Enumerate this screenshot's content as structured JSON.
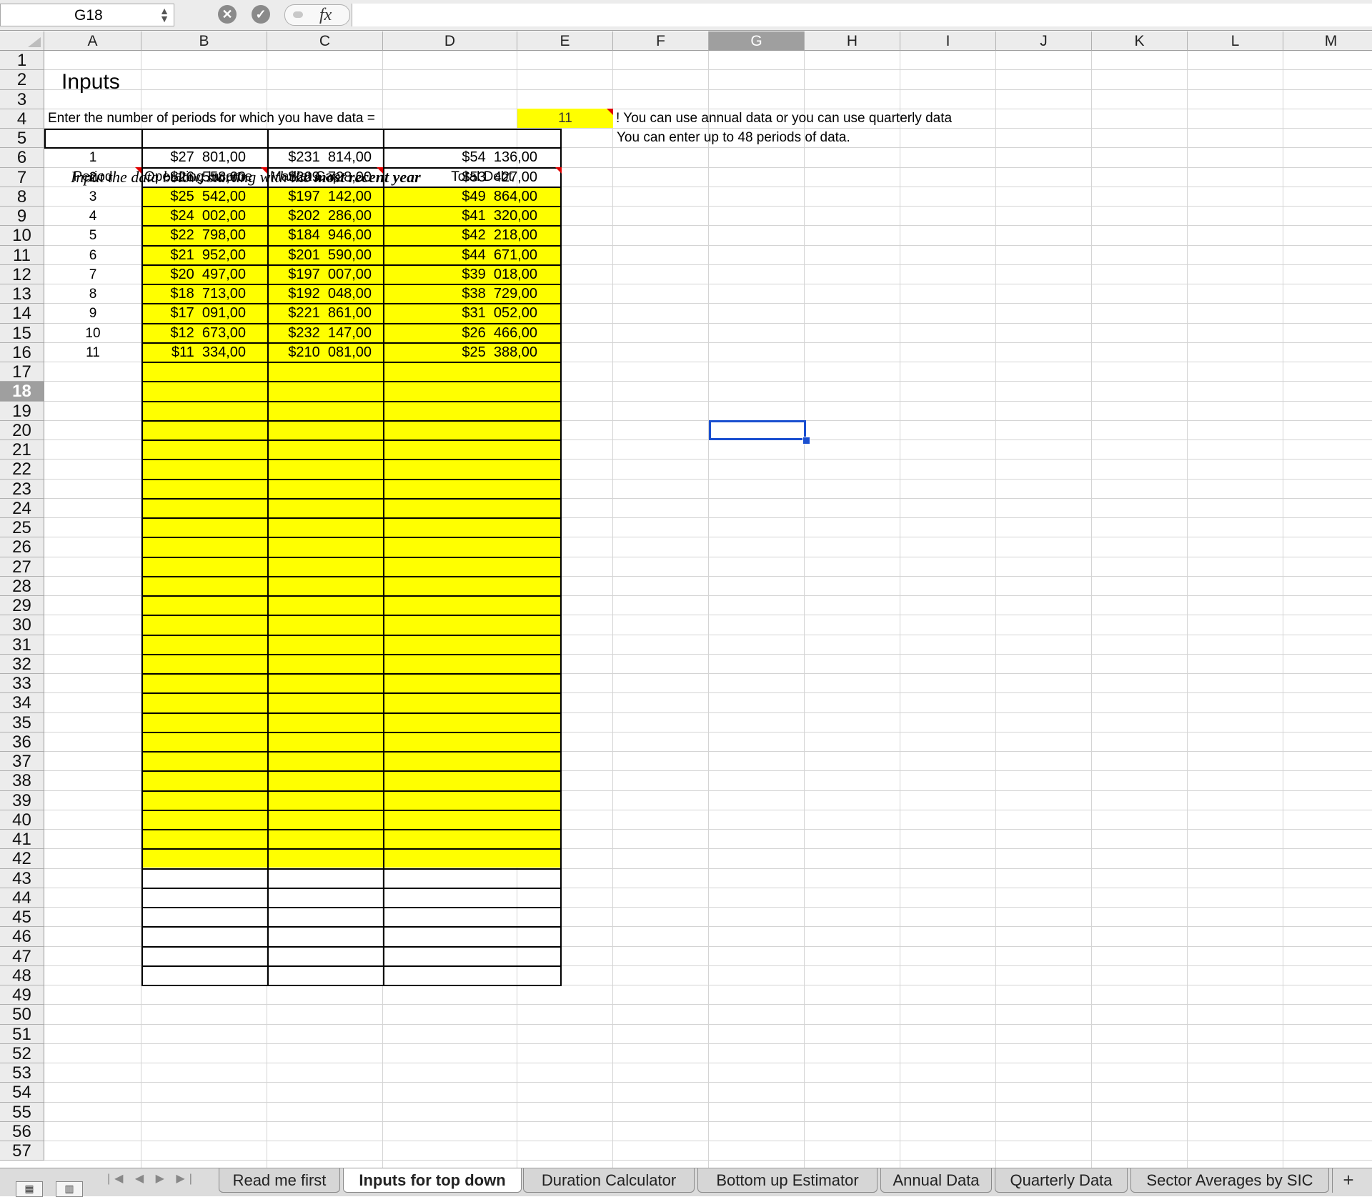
{
  "formula_bar": {
    "name_box": "G18",
    "cancel_icon": "✕",
    "confirm_icon": "✓",
    "fx_label": "fx",
    "formula": ""
  },
  "columns": [
    "A",
    "B",
    "C",
    "D",
    "E",
    "F",
    "G",
    "H",
    "I",
    "J",
    "K",
    "L",
    "M"
  ],
  "selected_column": "G",
  "rows": [
    "1",
    "2",
    "3",
    "4",
    "5",
    "6",
    "7",
    "8",
    "9",
    "10",
    "11",
    "12",
    "13",
    "14",
    "15",
    "16",
    "17",
    "18",
    "19",
    "20",
    "21",
    "22",
    "23",
    "24",
    "25",
    "26",
    "27",
    "28",
    "29",
    "30",
    "31",
    "32",
    "33",
    "34",
    "35",
    "36",
    "37",
    "38",
    "39",
    "40",
    "41",
    "42",
    "43",
    "44",
    "45",
    "46",
    "47",
    "48",
    "49",
    "50",
    "51",
    "52",
    "53",
    "54",
    "55",
    "56",
    "57"
  ],
  "selected_row": "18",
  "cells": {
    "title": "Inputs",
    "periods_prompt": "Enter the number of periods for which you have data =",
    "periods_value": "11",
    "note1": "! You can use annual data or you can use quarterly data",
    "note2": "You can enter up to 48 periods of data.",
    "instruction_prefix": "Input the data below, starting with the ",
    "instruction_emph": "most recent year"
  },
  "table": {
    "headers": [
      "Period",
      "Operating Income",
      "Market Cap",
      "Total Debt"
    ],
    "rows": [
      [
        "1",
        "$27  801,00",
        "$231  814,00",
        "$54  136,00"
      ],
      [
        "2",
        "$26  558,00",
        "$209  728,00",
        "$53  427,00"
      ],
      [
        "3",
        "$25  542,00",
        "$197  142,00",
        "$49  864,00"
      ],
      [
        "4",
        "$24  002,00",
        "$202  286,00",
        "$41  320,00"
      ],
      [
        "5",
        "$22  798,00",
        "$184  946,00",
        "$42  218,00"
      ],
      [
        "6",
        "$21  952,00",
        "$201  590,00",
        "$44  671,00"
      ],
      [
        "7",
        "$20  497,00",
        "$197  007,00",
        "$39  018,00"
      ],
      [
        "8",
        "$18  713,00",
        "$192  048,00",
        "$38  729,00"
      ],
      [
        "9",
        "$17  091,00",
        "$221  861,00",
        "$31  052,00"
      ],
      [
        "10",
        "$12  673,00",
        "$232  147,00",
        "$26  466,00"
      ],
      [
        "11",
        "$11  334,00",
        "$210  081,00",
        "$25  388,00"
      ]
    ]
  },
  "sheet_tabs": [
    "Read me first",
    "Inputs for top down",
    "Duration Calculator",
    "Bottom up Estimator",
    "Annual Data",
    "Quarterly Data",
    "Sector Averages by SIC"
  ],
  "active_tab": "Inputs for top down",
  "add_tab_label": "+",
  "nav_arrows": "|◀ ◀ ▶ ▶|",
  "colors": {
    "input_fill": "#ffff00",
    "selection": "#1a4fd0",
    "comment_marker": "#e00000"
  }
}
